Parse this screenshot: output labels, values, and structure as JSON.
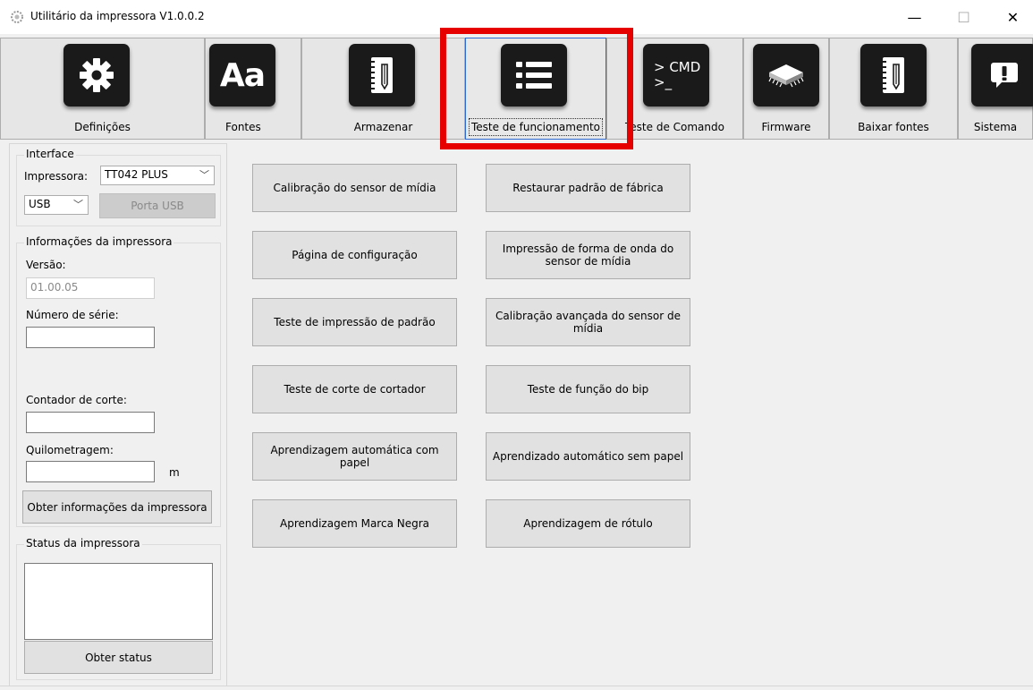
{
  "window": {
    "title": "Utilitário da impressora  V1.0.0.2",
    "minimize": "—",
    "maximize": "☐",
    "close": "✕"
  },
  "toolbar": {
    "items": [
      {
        "label": "Definições",
        "icon": "gear-icon"
      },
      {
        "label": "Fontes",
        "icon": "font-icon"
      },
      {
        "label": "Armazenar",
        "icon": "notebook-pencil-icon"
      },
      {
        "label": "Teste de funcionamento",
        "icon": "list-icon",
        "selected": true
      },
      {
        "label": "Teste de Comando",
        "icon": "terminal-cmd-icon",
        "icon_text": "> CMD\n>_"
      },
      {
        "label": "Firmware",
        "icon": "chip-icon"
      },
      {
        "label": "Baixar fontes",
        "icon": "notebook-pencil-icon"
      },
      {
        "label": "Sistema",
        "icon": "alert-icon"
      }
    ]
  },
  "interface": {
    "legend": "Interface",
    "printer_label": "Impressora:",
    "printer_value": "TT042 PLUS",
    "port_value": "USB",
    "usb_port_button": "Porta USB"
  },
  "printer_info": {
    "legend": "Informações da impressora",
    "version_label": "Versão:",
    "version_value": "01.00.05",
    "serial_label": "Número de série:",
    "serial_value": "",
    "cut_counter_label": "Contador de corte:",
    "cut_counter_value": "",
    "mileage_label": "Quilometragem:",
    "mileage_value": "",
    "mileage_unit": "m",
    "get_info_button": "Obter informações da impressora"
  },
  "printer_status": {
    "legend": "Status da impressora",
    "status_text": "",
    "get_status_button": "Obter status"
  },
  "tests": {
    "left": [
      "Calibração do sensor de mídia",
      "Página de configuração",
      "Teste de impressão de padrão",
      "Teste de corte de cortador",
      "Aprendizagem automática com papel",
      "Aprendizagem Marca Negra"
    ],
    "right": [
      "Restaurar padrão de fábrica",
      "Impressão de forma de onda do sensor de mídia",
      "Calibração avançada do sensor de mídia",
      "Teste de função do bip",
      "Aprendizado automático sem papel",
      "Aprendizagem de rótulo"
    ]
  },
  "colors": {
    "highlight": "#e60000",
    "icon_bg": "#1a1a1a",
    "window_bg": "#f0f0f0"
  }
}
